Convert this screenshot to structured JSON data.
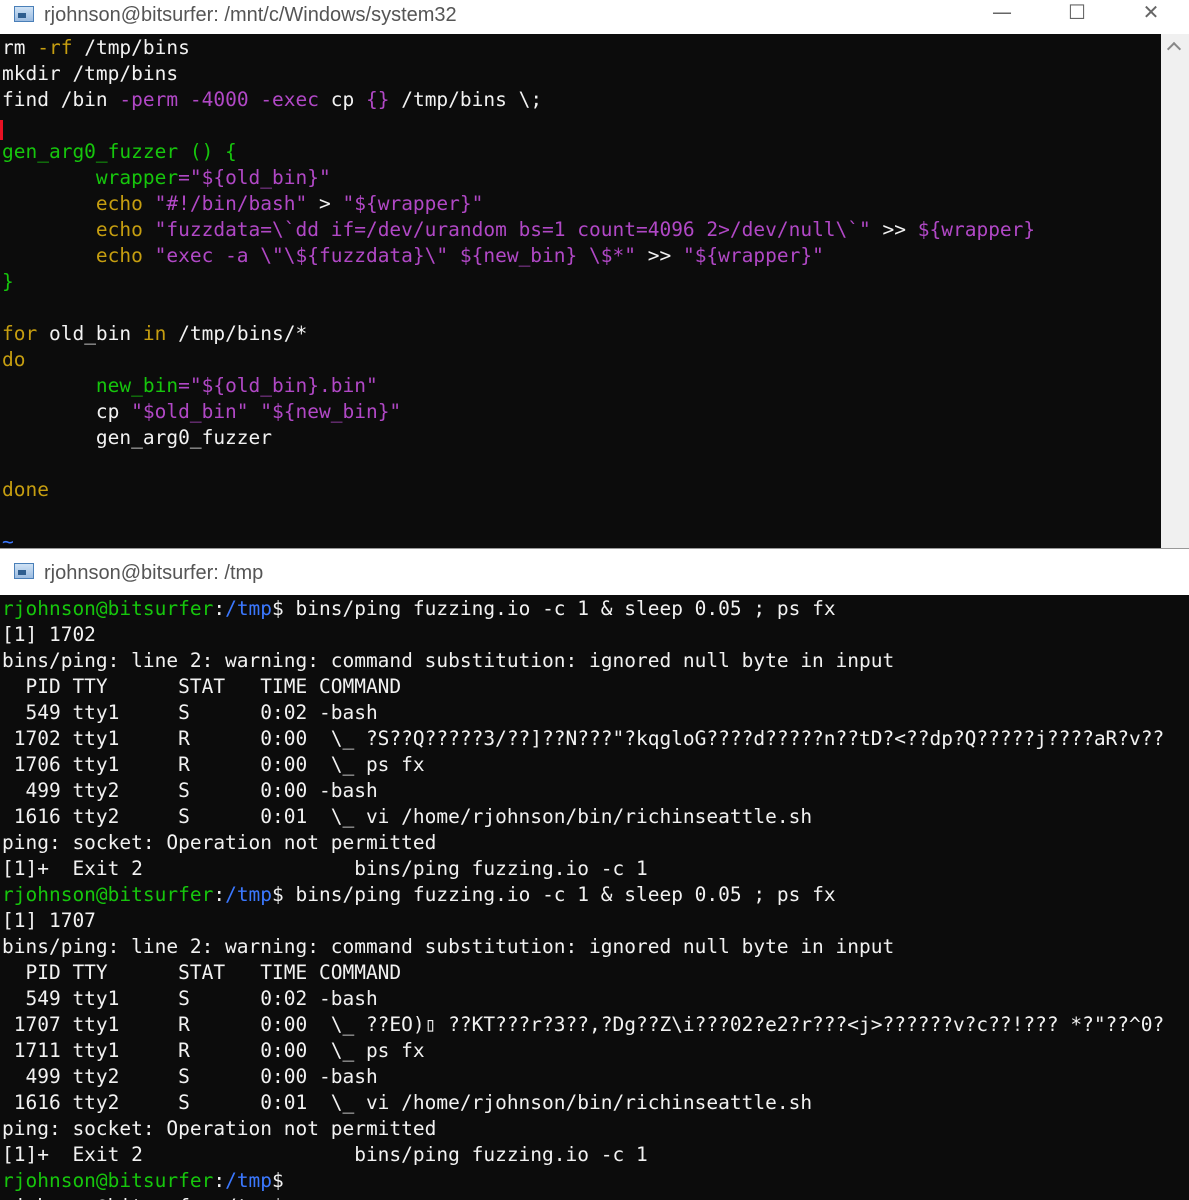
{
  "colors": {
    "terminal_bg": "#0c0c0c",
    "default": "#f2f2f2",
    "vim_keyword": "#c69e10",
    "vim_option": "#b148c6",
    "vim_string": "#b148c6",
    "vim_identifier": "#3bbfd6",
    "vim_func": "#16c60c",
    "prompt_user": "#16c60c",
    "prompt_path": "#3b78ff"
  },
  "top_window": {
    "title": "rjohnson@bitsurfer: /mnt/c/Windows/system32",
    "buttons": {
      "minimize": "—",
      "maximize": "☐",
      "close": "✕"
    },
    "lines": [
      [
        [
          "rm ",
          "d"
        ],
        [
          "-rf",
          "k"
        ],
        [
          " /tmp/bins",
          "d"
        ]
      ],
      [
        [
          "mkdir /tmp/bins",
          "d"
        ]
      ],
      [
        [
          "find /bin ",
          "d"
        ],
        [
          "-perm",
          "o"
        ],
        [
          " ",
          "d"
        ],
        [
          "-4000",
          "r"
        ],
        [
          " ",
          "d"
        ],
        [
          "-exec",
          "o"
        ],
        [
          " cp ",
          "d"
        ],
        [
          "{}",
          "o"
        ],
        [
          " /tmp/bins \\;",
          "d"
        ]
      ],
      [],
      [
        [
          "gen_arg0_fuzzer () {",
          "f"
        ]
      ],
      [
        [
          "        ",
          "d"
        ],
        [
          "wrapper",
          "f"
        ],
        [
          "=\"${old_bin}\"",
          "o"
        ]
      ],
      [
        [
          "        ",
          "d"
        ],
        [
          "echo",
          "k"
        ],
        [
          " \"#!/bin/bash\" ",
          "o"
        ],
        [
          ">",
          "d"
        ],
        [
          " \"${wrapper}\"",
          "o"
        ]
      ],
      [
        [
          "        ",
          "d"
        ],
        [
          "echo",
          "k"
        ],
        [
          " \"fuzzdata=\\`dd if=/dev/urandom bs=1 count=4096 2>/dev/null\\`\"",
          "o"
        ],
        [
          " >> ",
          "d"
        ],
        [
          "${wrapper}",
          "o"
        ]
      ],
      [
        [
          "        ",
          "d"
        ],
        [
          "echo",
          "k"
        ],
        [
          " \"exec -a \\\"\\${fuzzdata}\\\" ${new_bin} \\$*\"",
          "o"
        ],
        [
          " >> ",
          "d"
        ],
        [
          "\"${wrapper}\"",
          "o"
        ]
      ],
      [
        [
          "}",
          "f"
        ]
      ],
      [],
      [
        [
          "for",
          "k"
        ],
        [
          " old_bin ",
          "d"
        ],
        [
          "in",
          "k"
        ],
        [
          " /tmp/bins/*",
          "d"
        ]
      ],
      [
        [
          "do",
          "k"
        ]
      ],
      [
        [
          "        ",
          "d"
        ],
        [
          "new_bin",
          "f"
        ],
        [
          "=\"${old_bin}.bin\"",
          "o"
        ]
      ],
      [
        [
          "        cp ",
          "d"
        ],
        [
          "\"$old_bin\"",
          "o"
        ],
        [
          " ",
          "d"
        ],
        [
          "\"${new_bin}\"",
          "o"
        ]
      ],
      [
        [
          "        gen_arg0_fuzzer",
          "d"
        ]
      ],
      [],
      [
        [
          "done",
          "k"
        ]
      ],
      [],
      [
        [
          "~",
          "p"
        ]
      ]
    ]
  },
  "bottom_window": {
    "title": "rjohnson@bitsurfer: /tmp",
    "lines": [
      [
        [
          "rjohnson@bitsurfer",
          "u"
        ],
        [
          ":",
          "d"
        ],
        [
          "/tmp",
          "p"
        ],
        [
          "$ bins/ping fuzzing.io -c 1 & sleep 0.05 ; ps fx",
          "d"
        ]
      ],
      [
        [
          "[1] 1702",
          "d"
        ]
      ],
      [
        [
          "bins/ping: line 2: warning: command substitution: ignored null byte in input",
          "d"
        ]
      ],
      [
        [
          "  PID TTY      STAT   TIME COMMAND",
          "d"
        ]
      ],
      [
        [
          "  549 tty1     S      0:02 -bash",
          "d"
        ]
      ],
      [
        [
          " 1702 tty1     R      0:00  \\_ ?S??Q?????3/??]??N???\"?kqgloG????d?????n??tD?<??dp?Q?????j????aR?v??",
          "d"
        ]
      ],
      [
        [
          " 1706 tty1     R      0:00  \\_ ps fx",
          "d"
        ]
      ],
      [
        [
          "  499 tty2     S      0:00 -bash",
          "d"
        ]
      ],
      [
        [
          " 1616 tty2     S      0:01  \\_ vi /home/rjohnson/bin/richinseattle.sh",
          "d"
        ]
      ],
      [
        [
          "ping: socket: Operation not permitted",
          "d"
        ]
      ],
      [
        [
          "[1]+  Exit 2                  bins/ping fuzzing.io -c 1",
          "d"
        ]
      ],
      [
        [
          "rjohnson@bitsurfer",
          "u"
        ],
        [
          ":",
          "d"
        ],
        [
          "/tmp",
          "p"
        ],
        [
          "$ bins/ping fuzzing.io -c 1 & sleep 0.05 ; ps fx",
          "d"
        ]
      ],
      [
        [
          "[1] 1707",
          "d"
        ]
      ],
      [
        [
          "bins/ping: line 2: warning: command substitution: ignored null byte in input",
          "d"
        ]
      ],
      [
        [
          "  PID TTY      STAT   TIME COMMAND",
          "d"
        ]
      ],
      [
        [
          "  549 tty1     S      0:02 -bash",
          "d"
        ]
      ],
      [
        [
          " 1707 tty1     R      0:00  \\_ ??EO)▯ ??KT???r?3??,?Dg??Z\\i???02?e2?r???<j>??????v?c??!??? *?\"??^0?",
          "d"
        ]
      ],
      [
        [
          " 1711 tty1     R      0:00  \\_ ps fx",
          "d"
        ]
      ],
      [
        [
          "  499 tty2     S      0:00 -bash",
          "d"
        ]
      ],
      [
        [
          " 1616 tty2     S      0:01  \\_ vi /home/rjohnson/bin/richinseattle.sh",
          "d"
        ]
      ],
      [
        [
          "ping: socket: Operation not permitted",
          "d"
        ]
      ],
      [
        [
          "[1]+  Exit 2                  bins/ping fuzzing.io -c 1",
          "d"
        ]
      ],
      [
        [
          "rjohnson@bitsurfer",
          "u"
        ],
        [
          ":",
          "d"
        ],
        [
          "/tmp",
          "p"
        ],
        [
          "$",
          "d"
        ]
      ],
      [
        [
          "rjohnson@bitsurfer:/tmp$",
          "d"
        ]
      ]
    ]
  }
}
